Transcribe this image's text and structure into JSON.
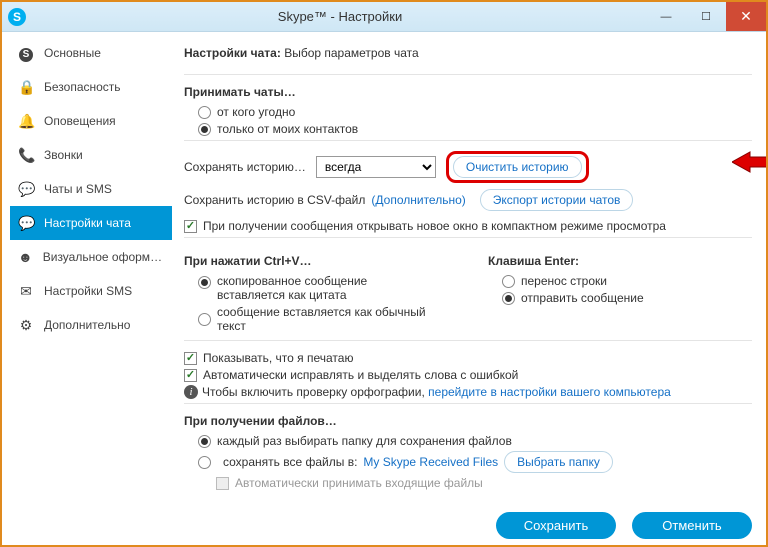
{
  "window": {
    "title": "Skype™ - Настройки"
  },
  "sidebar": {
    "items": [
      {
        "icon": "skype",
        "label": "Основные"
      },
      {
        "icon": "lock",
        "label": "Безопасность"
      },
      {
        "icon": "bell",
        "label": "Оповещения"
      },
      {
        "icon": "phone",
        "label": "Звонки"
      },
      {
        "icon": "chat",
        "label": "Чаты и SMS"
      },
      {
        "icon": "chat",
        "label": "Настройки чата"
      },
      {
        "icon": "smile",
        "label": "Визуальное оформле…"
      },
      {
        "icon": "sms",
        "label": "Настройки SMS"
      },
      {
        "icon": "gear",
        "label": "Дополнительно"
      }
    ],
    "active_index": 5
  },
  "header": {
    "title_bold": "Настройки чата:",
    "title_rest": "Выбор параметров чата"
  },
  "accept": {
    "heading": "Принимать чаты…",
    "opt_anyone": "от кого угодно",
    "opt_contacts": "только от моих контактов",
    "selected": "contacts"
  },
  "history": {
    "label": "Сохранять историю…",
    "select_value": "всегда",
    "clear_btn": "Очистить историю",
    "csv_label": "Сохранить историю в CSV-файл",
    "csv_more": "(Дополнительно)",
    "export_btn": "Экспорт истории чатов"
  },
  "compact": {
    "label": "При получении сообщения открывать новое окно в компактном режиме просмотра",
    "checked": true
  },
  "ctrlv": {
    "heading": "При нажатии Ctrl+V…",
    "opt_quote": "скопированное сообщение вставляется как цитата",
    "opt_plain": "сообщение вставляется как обычный текст",
    "selected": "quote"
  },
  "enter": {
    "heading": "Клавиша Enter:",
    "opt_newline": "перенос строки",
    "opt_send": "отправить сообщение",
    "selected": "send"
  },
  "typing": {
    "show_typing": "Показывать, что я печатаю",
    "show_typing_checked": true,
    "autocorrect": "Автоматически исправлять и выделять слова с ошибкой",
    "autocorrect_checked": true,
    "spell_prefix": "Чтобы включить проверку орфографии,",
    "spell_link": "перейдите в настройки вашего компьютера"
  },
  "files": {
    "heading": "При получении файлов…",
    "opt_ask": "каждый раз выбирать папку для сохранения файлов",
    "opt_save": "сохранять все файлы в:",
    "folder": "My Skype Received Files",
    "choose_btn": "Выбрать папку",
    "auto_accept": "Автоматически принимать входящие файлы",
    "selected": "ask"
  },
  "footer": {
    "save": "Сохранить",
    "cancel": "Отменить"
  }
}
